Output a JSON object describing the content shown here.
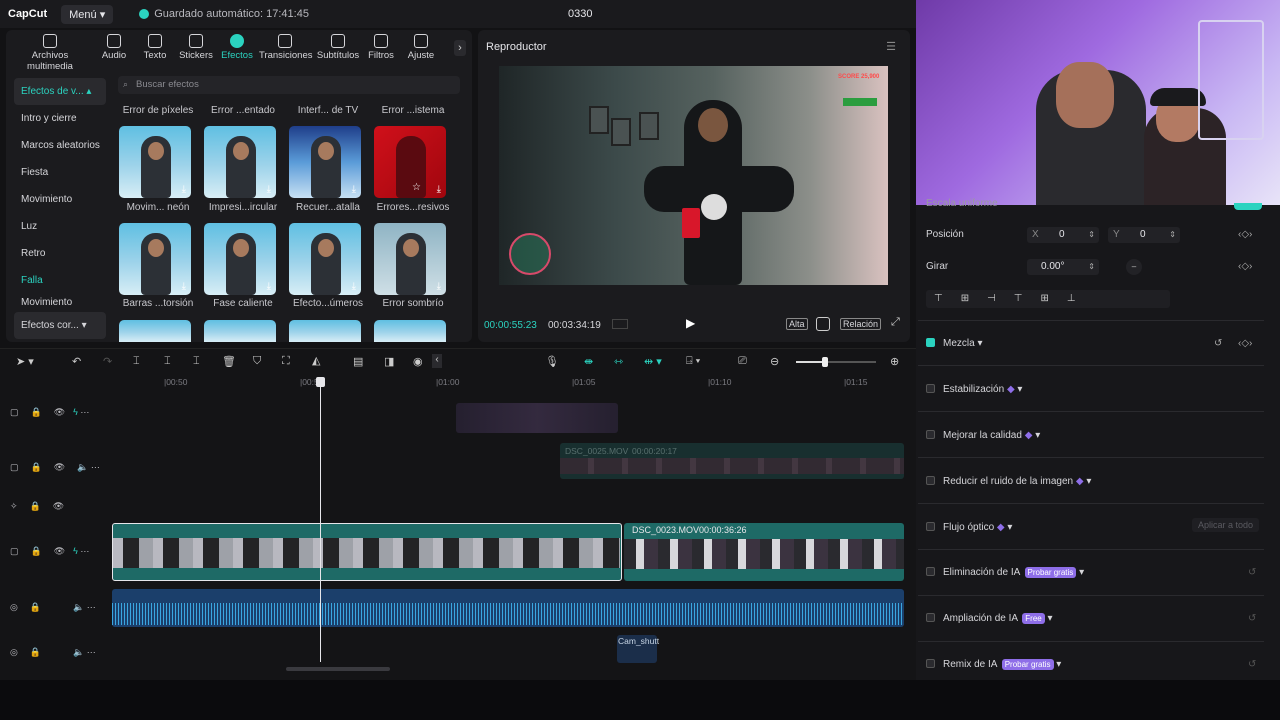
{
  "topbar": {
    "logo": "CapCut",
    "menu": "Menú",
    "autosave": "Guardado automático: 17:41:45",
    "project": "0330"
  },
  "tools": [
    {
      "label": "Archivos multimedia",
      "icon": "media-icon"
    },
    {
      "label": "Audio",
      "icon": "audio-icon"
    },
    {
      "label": "Texto",
      "icon": "text-icon"
    },
    {
      "label": "Stickers",
      "icon": "stickers-icon"
    },
    {
      "label": "Efectos",
      "icon": "effects-icon",
      "active": true
    },
    {
      "label": "Transiciones",
      "icon": "transitions-icon"
    },
    {
      "label": "Subtítulos",
      "icon": "subtitles-icon"
    },
    {
      "label": "Filtros",
      "icon": "filters-icon"
    },
    {
      "label": "Ajuste",
      "icon": "adjust-icon"
    }
  ],
  "categories": {
    "header": "Efectos de v...",
    "items": [
      "Intro y cierre",
      "Marcos aleatorios",
      "Fiesta",
      "Movimiento",
      "Luz",
      "Retro",
      "Falla",
      "Movimiento"
    ],
    "footer": "Efectos cor..."
  },
  "search": {
    "placeholder": "Buscar efectos"
  },
  "effects_top_labels": [
    "Error de píxeles",
    "Error ...entado",
    "Interf... de TV",
    "Error ...istema"
  ],
  "effects_row1": [
    "Movim... neón",
    "Impresi...ircular",
    "Recuer...atalla",
    "Errores...resivos"
  ],
  "effects_row2": [
    "Barras ...torsión",
    "Fase caliente",
    "Efecto...úmeros",
    "Error sombrío"
  ],
  "player": {
    "title": "Reproductor",
    "current": "00:00:55:23",
    "total": "00:03:34:19",
    "quality": "Alta",
    "ratio": "Relación",
    "overlay": "SCORE 25,900"
  },
  "timeline": {
    "ruler": [
      "|00:50",
      "|00:55",
      "|01:00",
      "|01:05",
      "|01:10",
      "|01:15"
    ],
    "clip_main": "DSC_0023.MOV",
    "clip_main_dur": "00:00:36:26",
    "clip_ghost": "DSC_0025.MOV",
    "clip_ghost_dur": "00:00:20:17",
    "audio_clip": "Cam_shutt"
  },
  "right": {
    "scale_label": "Escala uniforme",
    "position_label": "Posición",
    "x_label": "X",
    "x": "0",
    "y_label": "Y",
    "y": "0",
    "rotate_label": "Girar",
    "rotate": "0.00°",
    "options": [
      {
        "label": "Mezcla",
        "checked": true
      },
      {
        "label": "Estabilización",
        "badge": ""
      },
      {
        "label": "Mejorar la calidad",
        "badge": ""
      },
      {
        "label": "Reducir el ruido de la imagen",
        "badge": ""
      },
      {
        "label": "Flujo óptico",
        "badge": "",
        "extra": "Aplicar a todo"
      },
      {
        "label": "Eliminación de IA",
        "badge": "Probar gratis"
      },
      {
        "label": "Ampliación de IA",
        "badge": "Free"
      },
      {
        "label": "Remix de IA",
        "badge": "Probar gratis"
      }
    ]
  }
}
